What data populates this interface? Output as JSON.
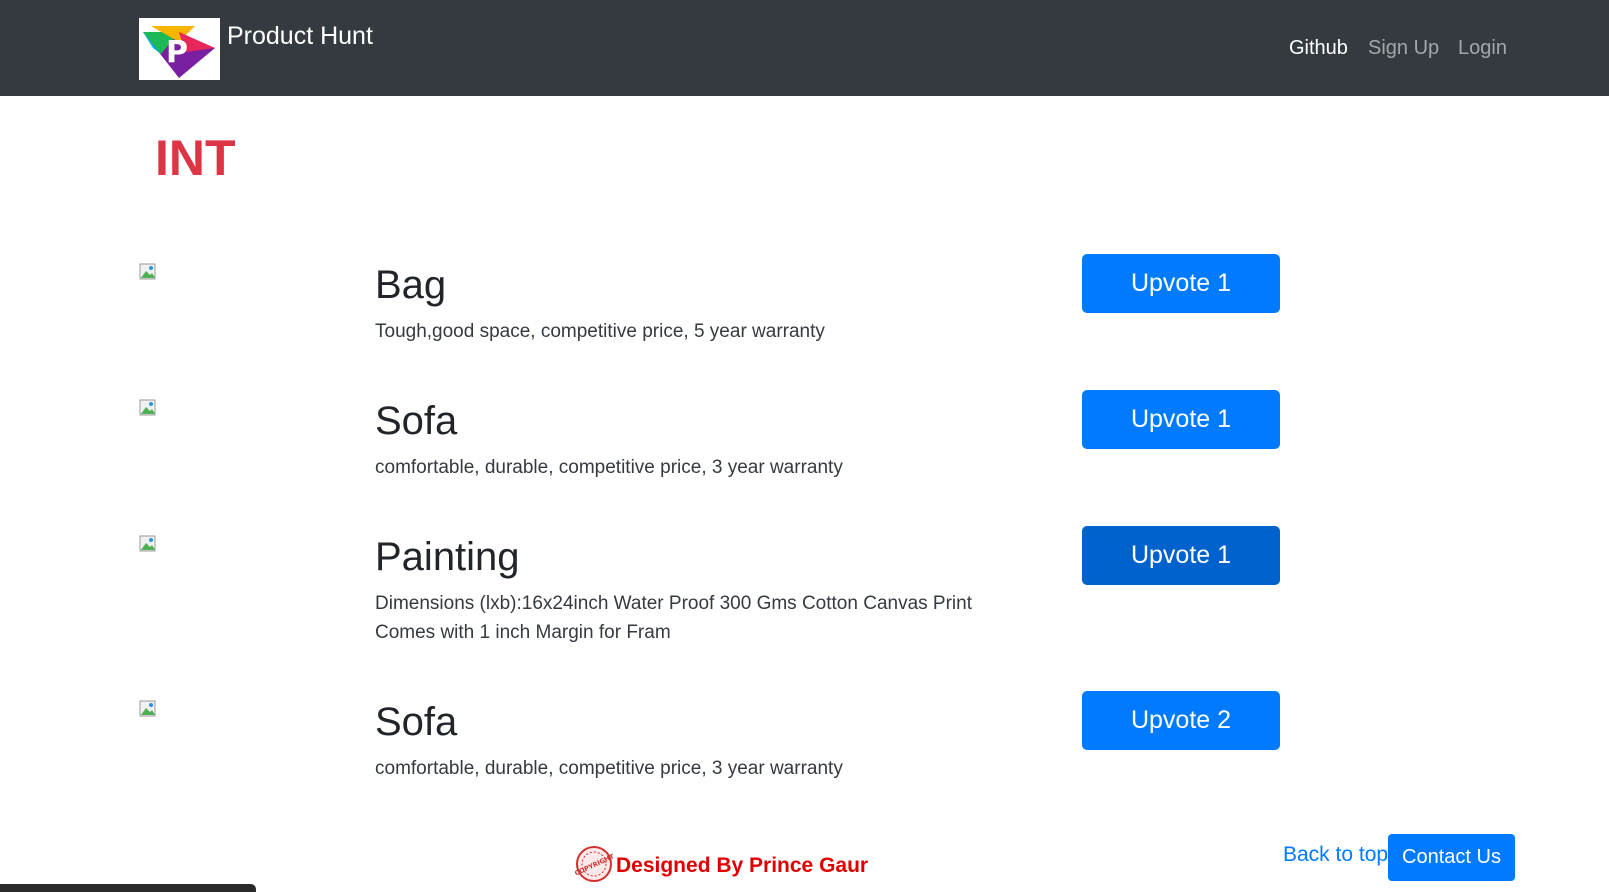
{
  "navbar": {
    "brand_name": "Product Hunt",
    "brand_logo_letter": "P",
    "links": {
      "github": "Github",
      "signup": "Sign Up",
      "login": "Login"
    }
  },
  "marquee": {
    "text": "INT"
  },
  "products": [
    {
      "title": "Bag",
      "description": "Tough,good space, competitive price, 5 year warranty",
      "upvote_label": "Upvote 1"
    },
    {
      "title": "Sofa",
      "description": "comfortable, durable, competitive price, 3 year warranty",
      "upvote_label": "Upvote 1"
    },
    {
      "title": "Painting",
      "description": "Dimensions (lxb):16x24inch Water Proof 300 Gms Cotton Canvas Print Comes with 1 inch Margin for Fram",
      "upvote_label": "Upvote 1"
    },
    {
      "title": "Sofa",
      "description": "comfortable, durable, competitive price, 3 year warranty",
      "upvote_label": "Upvote 2"
    }
  ],
  "footer": {
    "credit_text": "Designed By Prince Gaur",
    "seal_text": "COPYRIGHT",
    "back_to_top": "Back to top",
    "contact_label": "Contact Us"
  },
  "colors": {
    "navbar": "#343a40",
    "primary": "#007bff",
    "marquee": "#dc3545",
    "credit": "#e00000"
  }
}
